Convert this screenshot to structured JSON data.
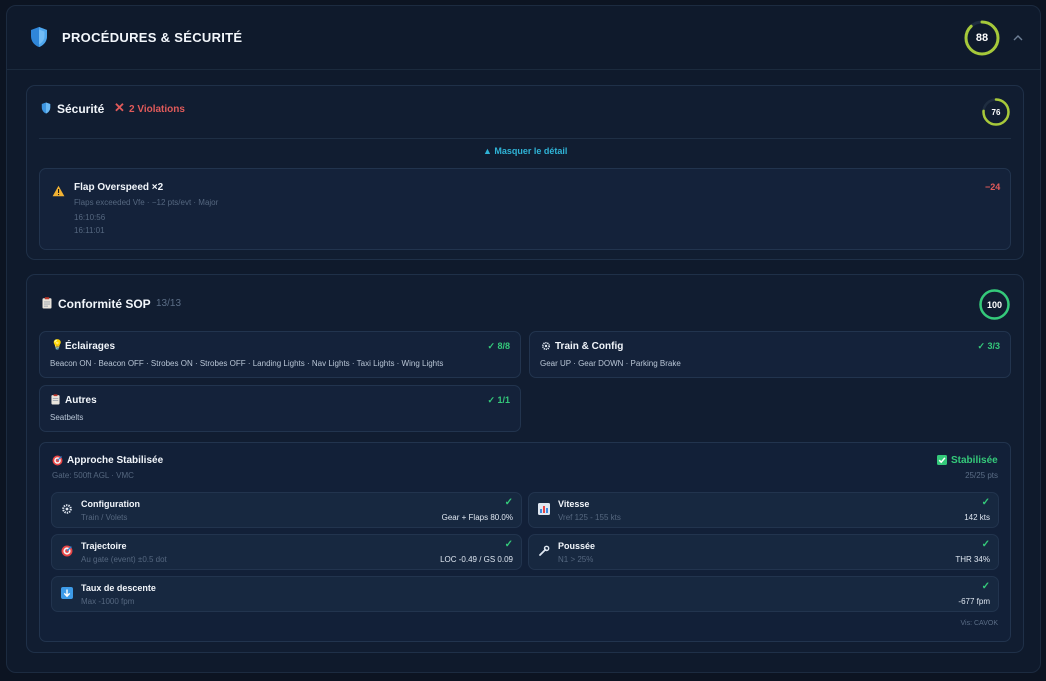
{
  "header": {
    "title": "PROCÉDURES & SÉCURITÉ",
    "score": "88",
    "score_pct": 88,
    "icons": {
      "shield": "shield-icon",
      "collapse": "chevron-up-icon"
    }
  },
  "security": {
    "title": "Sécurité",
    "violations_label": "2 Violations",
    "score": "76",
    "score_pct": 76,
    "toggle_label": "▲ Masquer le détail",
    "violation": {
      "title": "Flap Overspeed ×2",
      "detail": "Flaps exceeded Vfe · −12 pts/evt · Major",
      "times": [
        "16:10:56",
        "16:11:01"
      ],
      "penalty": "−24"
    }
  },
  "sop": {
    "title": "Conformité SOP",
    "count": "13/13",
    "score": "100",
    "score_pct": 100,
    "groups": [
      {
        "title": "Éclairages",
        "status": "✓ 8/8",
        "items": "Beacon ON · Beacon OFF · Strobes ON · Strobes OFF · Landing Lights · Nav Lights · Taxi Lights · Wing Lights",
        "icon": "lightbulb-icon"
      },
      {
        "title": "Train & Config",
        "status": "✓ 3/3",
        "items": "Gear UP · Gear DOWN · Parking Brake",
        "icon": "gear-icon"
      },
      {
        "title": "Autres",
        "status": "✓ 1/1",
        "items": "Seatbelts",
        "icon": "clipboard-icon"
      }
    ]
  },
  "approach": {
    "title": "Approche Stabilisée",
    "gate": "Gate: 500ft AGL · VMC",
    "status": "Stabilisée",
    "points": "25/25 pts",
    "visibility": "Vis: CAVOK",
    "criteria": [
      {
        "title": "Configuration",
        "desc": "Train / Volets",
        "value": "Gear + Flaps 80.0%",
        "check": "✓",
        "icon": "gear-icon"
      },
      {
        "title": "Vitesse",
        "desc": "Vref 125 - 155 kts",
        "value": "142 kts",
        "check": "✓",
        "icon": "bar-chart-icon"
      },
      {
        "title": "Trajectoire",
        "desc": "Au gate (event) ±0.5 dot",
        "value": "LOC -0.49 / GS 0.09",
        "check": "✓",
        "icon": "target-icon"
      },
      {
        "title": "Poussée",
        "desc": "N1 > 25%",
        "value": "THR 34%",
        "check": "✓",
        "icon": "wrench-icon"
      },
      {
        "title": "Taux de descente",
        "desc": "Max -1000 fpm",
        "value": "-677 fpm",
        "check": "✓",
        "icon": "down-arrow-icon"
      }
    ]
  },
  "colors": {
    "ok": "#34c97a",
    "warn": "#e05a5a",
    "ring_88": "#a6c93a",
    "ring_76": "#a8c93a",
    "ring_100": "#34c97a",
    "accent": "#2fb3d6"
  }
}
